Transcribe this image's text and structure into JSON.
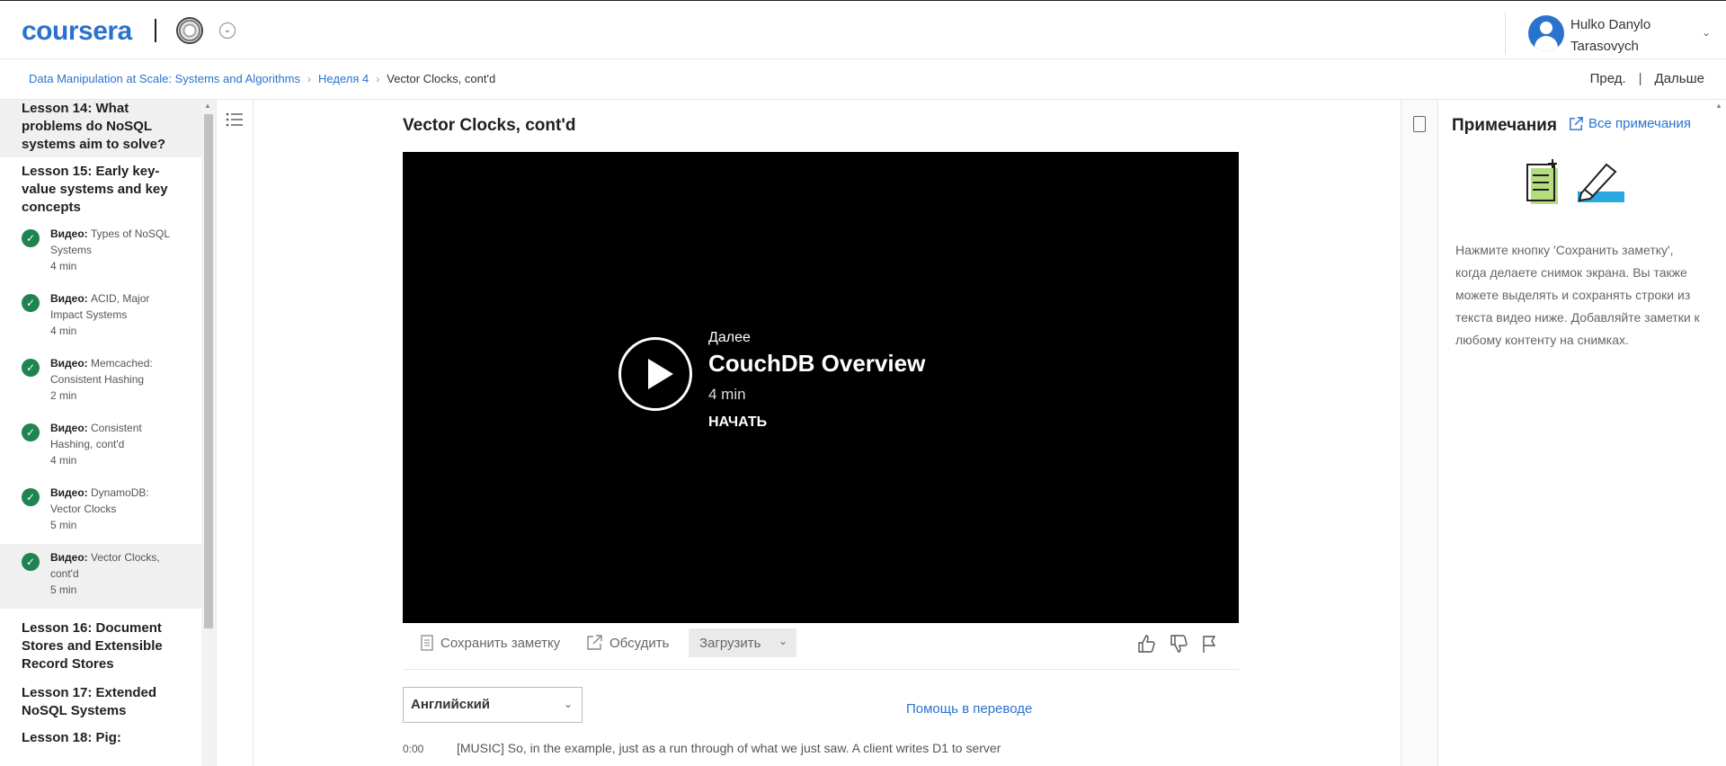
{
  "header": {
    "logo": "coursera",
    "user_name": "Hulko Danylo Tarasovych"
  },
  "breadcrumb": {
    "course": "Data Manipulation at Scale: Systems and Algorithms",
    "week": "Неделя 4",
    "current": "Vector Clocks, cont'd",
    "prev": "Пред.",
    "separator": "|",
    "next": "Дальше"
  },
  "sidebar": {
    "lessons": [
      {
        "title": "Lesson 14: What problems do NoSQL systems aim to solve?"
      },
      {
        "title": "Lesson 15: Early key-value systems and key concepts"
      },
      {
        "title": "Lesson 16: Document Stores and Extensible Record Stores"
      },
      {
        "title": "Lesson 17: Extended NoSQL Systems"
      },
      {
        "title": "Lesson 18: Pig:"
      }
    ],
    "items": [
      {
        "type": "Видео:",
        "title": "Types of NoSQL Systems",
        "duration": "4 min"
      },
      {
        "type": "Видео:",
        "title": "ACID, Major Impact Systems",
        "duration": "4 min"
      },
      {
        "type": "Видео:",
        "title": "Memcached: Consistent Hashing",
        "duration": "2 min"
      },
      {
        "type": "Видео:",
        "title": "Consistent Hashing, cont'd",
        "duration": "4 min"
      },
      {
        "type": "Видео:",
        "title": "DynamoDB: Vector Clocks",
        "duration": "5 min"
      },
      {
        "type": "Видео:",
        "title": "Vector Clocks, cont'd",
        "duration": "5 min"
      }
    ]
  },
  "main": {
    "title": "Vector Clocks, cont'd",
    "video": {
      "next_label": "Далее",
      "next_title": "CouchDB Overview",
      "next_duration": "4 min",
      "start_label": "НАЧАТЬ"
    },
    "toolbar": {
      "save_note": "Сохранить заметку",
      "discuss": "Обсудить",
      "download": "Загрузить"
    },
    "language": "Английский",
    "help_translate": "Помощь в переводе",
    "transcript": {
      "time": "0:00",
      "text": "[MUSIC] So, in the example, just as a run through of what we just saw. A client writes D1 to server"
    }
  },
  "notes": {
    "title": "Примечания",
    "all_notes": "Все примечания",
    "help_text": "Нажмите кнопку 'Сохранить заметку', когда делаете снимок экрана. Вы также можете выделять и сохранять строки из текста видео ниже. Добавляйте заметки к любому контенту на снимках."
  },
  "colors": {
    "brand": "#2a73cc",
    "completed": "#1f8354"
  }
}
